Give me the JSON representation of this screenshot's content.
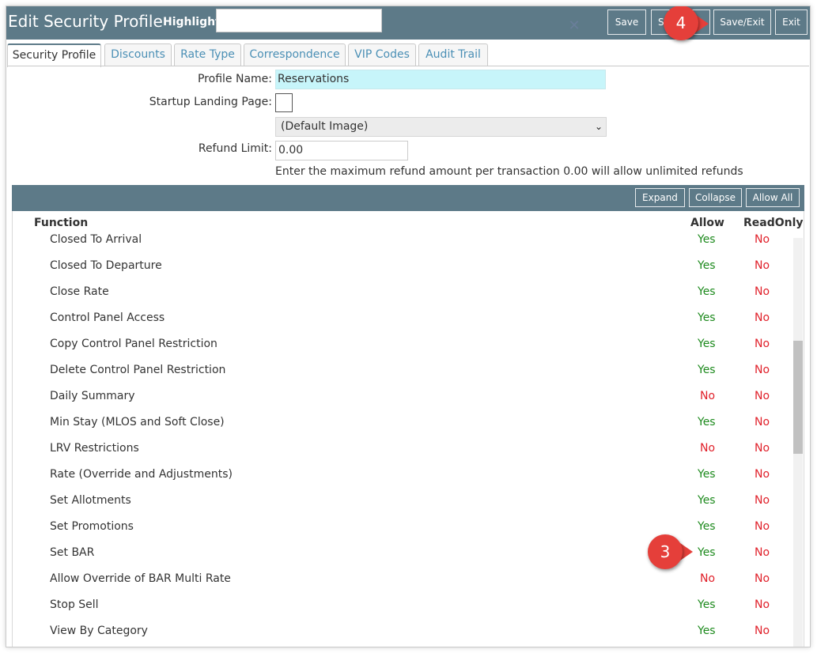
{
  "window": {
    "title": "Edit Security Profile"
  },
  "highlight": {
    "label": "Highlight:",
    "value": "",
    "placeholder": ""
  },
  "toolbar": {
    "save": "Save",
    "save_new_visible": "S",
    "save_exit": "Save/Exit",
    "exit": "Exit"
  },
  "annotations": {
    "badge_toolbar": "4",
    "badge_row": "3"
  },
  "tabs": [
    {
      "label": "Security Profile",
      "active": true
    },
    {
      "label": "Discounts",
      "active": false
    },
    {
      "label": "Rate Type",
      "active": false
    },
    {
      "label": "Correspondence",
      "active": false
    },
    {
      "label": "VIP Codes",
      "active": false
    },
    {
      "label": "Audit Trail",
      "active": false
    }
  ],
  "form": {
    "profile_name_label": "Profile Name:",
    "profile_name": "Reservations",
    "startup_label": "Startup Landing Page:",
    "startup_checked": false,
    "image_select": "(Default Image)",
    "refund_label": "Refund Limit:",
    "refund_value": "0.00",
    "refund_hint": "Enter the maximum refund amount per transaction 0.00 will allow unlimited refunds"
  },
  "section_buttons": {
    "expand": "Expand",
    "collapse": "Collapse",
    "allow_all": "Allow All"
  },
  "grid": {
    "headers": {
      "function": "Function",
      "allow": "Allow",
      "readonly": "ReadOnly"
    },
    "rows": [
      {
        "name": "Closed To Arrival",
        "allow": "Yes",
        "readonly": "No"
      },
      {
        "name": "Closed To Departure",
        "allow": "Yes",
        "readonly": "No"
      },
      {
        "name": "Close Rate",
        "allow": "Yes",
        "readonly": "No"
      },
      {
        "name": "Control Panel Access",
        "allow": "Yes",
        "readonly": "No"
      },
      {
        "name": "Copy Control Panel Restriction",
        "allow": "Yes",
        "readonly": "No"
      },
      {
        "name": "Delete Control Panel Restriction",
        "allow": "Yes",
        "readonly": "No"
      },
      {
        "name": "Daily Summary",
        "allow": "No",
        "readonly": "No"
      },
      {
        "name": "Min Stay (MLOS and Soft Close)",
        "allow": "Yes",
        "readonly": "No"
      },
      {
        "name": "LRV Restrictions",
        "allow": "No",
        "readonly": "No"
      },
      {
        "name": "Rate (Override and Adjustments)",
        "allow": "Yes",
        "readonly": "No"
      },
      {
        "name": "Set Allotments",
        "allow": "Yes",
        "readonly": "No"
      },
      {
        "name": "Set Promotions",
        "allow": "Yes",
        "readonly": "No"
      },
      {
        "name": "Set BAR",
        "allow": "Yes",
        "readonly": "No"
      },
      {
        "name": "Allow Override of BAR Multi Rate",
        "allow": "No",
        "readonly": "No"
      },
      {
        "name": "Stop Sell",
        "allow": "Yes",
        "readonly": "No"
      },
      {
        "name": "View By Category",
        "allow": "Yes",
        "readonly": "No"
      }
    ]
  },
  "colors": {
    "header_bg": "#5d7a88",
    "yes": "#1d8a1d",
    "no": "#e0202a",
    "badge": "#e53f3a",
    "profile_field": "#c7f5fa"
  }
}
